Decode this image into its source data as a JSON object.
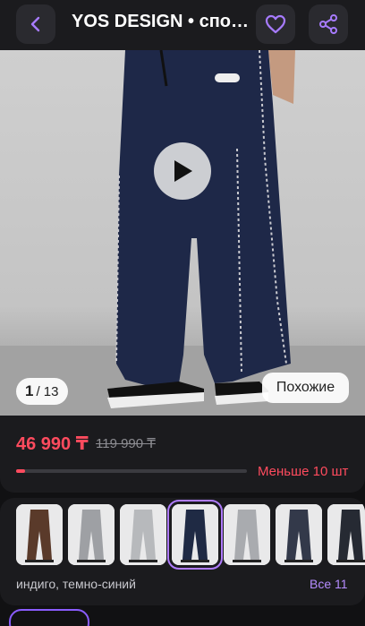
{
  "header": {
    "title": "YOS DESIGN • спортивные брюки",
    "back_icon": "chevron-left-icon",
    "favorite_icon": "heart-icon",
    "share_icon": "share-icon",
    "accent": "#a77bff"
  },
  "media": {
    "current_index": "1",
    "total": "/ 13",
    "similar_label": "Похожие",
    "play_icon": "play-icon"
  },
  "pricing": {
    "price": "46 990 ₸",
    "old_price": "119 990 ₸",
    "stock_text": "Меньше 10 шт",
    "stock_fraction": 0.04,
    "accent": "#ff4b5e"
  },
  "variants": {
    "color_name": "индиго, темно-синий",
    "all_label": "Все 11",
    "selected_index": 3,
    "thumbnails": [
      {
        "color": "#5a3a2a"
      },
      {
        "color": "#9ea0a4"
      },
      {
        "color": "#b7b9bc"
      },
      {
        "color": "#1f2a44"
      },
      {
        "color": "#a9abaf"
      },
      {
        "color": "#33394a"
      },
      {
        "color": "#262a33"
      }
    ]
  }
}
